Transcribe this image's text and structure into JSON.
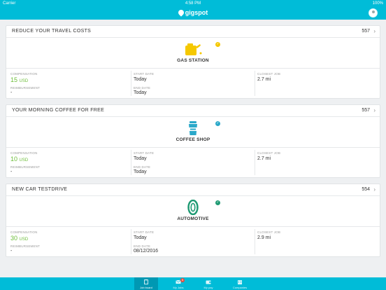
{
  "status": {
    "carrier": "Carrier",
    "time": "4:58 PM",
    "battery": "100%"
  },
  "app": {
    "logo_text": "gigspot"
  },
  "colors": {
    "brand": "#00bcd8",
    "compensation": "#6dbe3a",
    "badge": "#e74c3c"
  },
  "labels": {
    "compensation": "COMPENSATION",
    "reimbursement": "REIMBURSEMENT",
    "start_date": "START DATE",
    "end_date": "END DATE",
    "closest_job": "CLOSEST JOB"
  },
  "jobs": [
    {
      "title": "REDUCE YOUR TRAVEL COSTS",
      "count": "557",
      "category": "GAS STATION",
      "icon": "gas-can-icon",
      "badge_color": "#f5c800",
      "compensation_amount": "15",
      "compensation_unit": "USD",
      "reimbursement": "-",
      "start_date": "Today",
      "end_date": "Today",
      "closest_job": "2.7 mi"
    },
    {
      "title": "YOUR MORNING COFFEE FOR FREE",
      "count": "557",
      "category": "COFFEE SHOP",
      "icon": "coffee-cup-icon",
      "badge_color": "#2aa8c9",
      "compensation_amount": "10",
      "compensation_unit": "USD",
      "reimbursement": "-",
      "start_date": "Today",
      "end_date": "Today",
      "closest_job": "2.7 mi"
    },
    {
      "title": "NEW CAR TESTDRIVE",
      "count": "554",
      "category": "AUTOMOTIVE",
      "icon": "tire-icon",
      "badge_color": "#1f9a73",
      "compensation_amount": "30",
      "compensation_unit": "USD",
      "reimbursement": "-",
      "start_date": "Today",
      "end_date": "08/12/2016",
      "closest_job": "2.9 mi"
    }
  ],
  "tabs": [
    {
      "label": "Job board",
      "icon": "clipboard-icon",
      "active": true
    },
    {
      "label": "My Jobs",
      "icon": "envelope-icon",
      "badge": "5"
    },
    {
      "label": "My pay",
      "icon": "wallet-icon"
    },
    {
      "label": "Companies",
      "icon": "building-icon"
    }
  ]
}
